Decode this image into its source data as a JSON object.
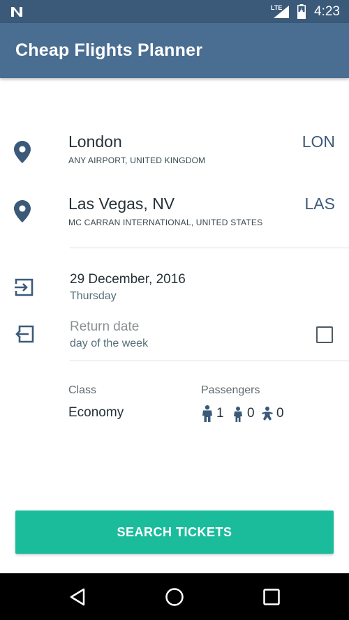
{
  "status_bar": {
    "network_label": "LTE",
    "time": "4:23"
  },
  "app_bar": {
    "title": "Cheap Flights Planner"
  },
  "origin": {
    "city": "London",
    "detail": "ANY AIRPORT, UNITED KINGDOM",
    "code": "LON"
  },
  "destination": {
    "city": "Las Vegas, NV",
    "detail": "MC CARRAN INTERNATIONAL, UNITED STATES",
    "code": "LAS"
  },
  "departure": {
    "date": "29 December, 2016",
    "weekday": "Thursday"
  },
  "return": {
    "date_placeholder": "Return date",
    "weekday_placeholder": "day of the week",
    "checked": false
  },
  "travel_class": {
    "label": "Class",
    "value": "Economy"
  },
  "passengers": {
    "label": "Passengers",
    "adults": "1",
    "children": "0",
    "infants": "0"
  },
  "search_button": {
    "label": "SEARCH TICKETS"
  },
  "colors": {
    "status_bar": "#3b5a7a",
    "app_bar": "#4a6e92",
    "accent": "#1abc9c",
    "icon": "#3b5a7a"
  },
  "icons": [
    "notification-n-icon",
    "signal-icon",
    "battery-icon",
    "location-pin-icon",
    "depart-icon",
    "return-icon",
    "adult-icon",
    "child-icon",
    "infant-icon",
    "back-icon",
    "home-icon",
    "recents-icon"
  ]
}
